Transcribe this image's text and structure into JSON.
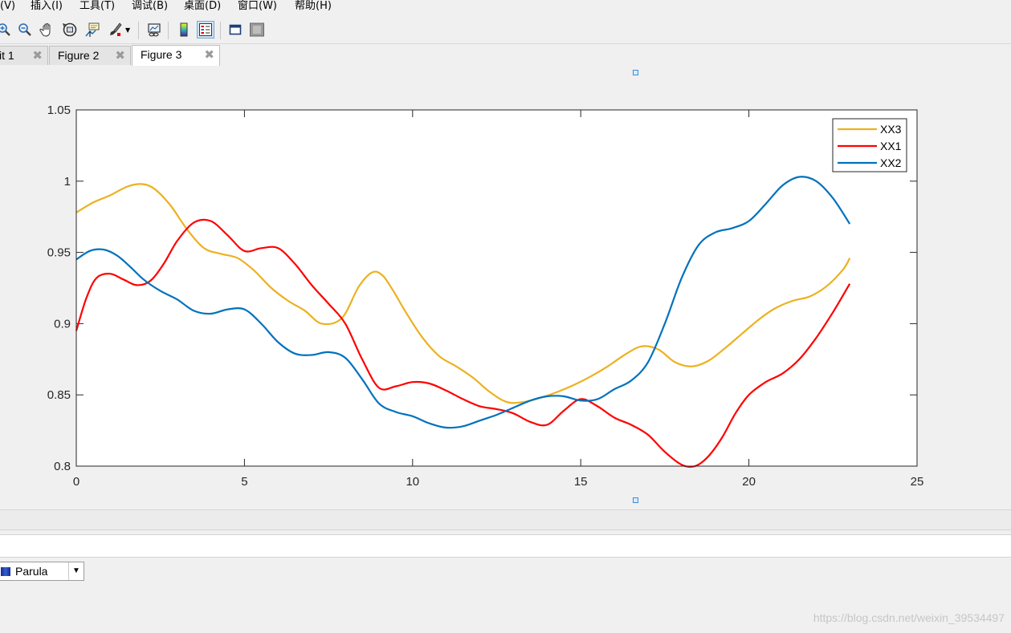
{
  "menubar": {
    "items": [
      "(V)",
      "插入(I)",
      "工具(T)",
      "调试(B)",
      "桌面(D)",
      "窗口(W)",
      "帮助(H)"
    ]
  },
  "toolbar": {
    "buttons": [
      {
        "icon": "zoom-in-icon"
      },
      {
        "icon": "zoom-out-icon"
      },
      {
        "icon": "pan-hand-icon"
      },
      {
        "icon": "rotate-3d-icon"
      },
      {
        "icon": "data-cursor-icon"
      },
      {
        "icon": "brush-icon"
      },
      {
        "icon": "link-plot-icon"
      },
      {
        "icon": "colorbar-icon"
      },
      {
        "icon": "legend-icon",
        "pressed": true
      },
      {
        "icon": "hide-plot-tools-icon"
      },
      {
        "icon": "show-plot-tools-icon"
      }
    ]
  },
  "tabs": [
    {
      "label": "it 1",
      "active": false
    },
    {
      "label": "Figure 2",
      "active": false
    },
    {
      "label": "Figure 3",
      "active": true
    }
  ],
  "colormap": {
    "selected": "Parula"
  },
  "watermark": "https://blog.csdn.net/weixin_39534497",
  "colors": {
    "XX3": "#EDB120",
    "XX1": "#FF0000",
    "XX2": "#0072BD"
  },
  "chart_data": {
    "type": "line",
    "title": "",
    "xlabel": "",
    "ylabel": "",
    "xlim": [
      0,
      25
    ],
    "ylim": [
      0.8,
      1.05
    ],
    "xticks": [
      "0",
      "5",
      "10",
      "15",
      "20",
      "25"
    ],
    "yticks": [
      "0.8",
      "0.85",
      "0.9",
      "0.95",
      "1",
      "1.05"
    ],
    "grid": false,
    "legend_position": "top-right",
    "series": [
      {
        "name": "XX3",
        "color": "#EDB120",
        "x": [
          0,
          0.5,
          1,
          1.5,
          1.9,
          2.3,
          2.8,
          3.3,
          3.8,
          4.3,
          4.8,
          5.3,
          5.8,
          6.3,
          6.8,
          7.3,
          7.9,
          8.4,
          8.8,
          9.1,
          9.4,
          9.8,
          10.3,
          10.8,
          11.3,
          11.8,
          12.3,
          12.8,
          13.3,
          13.8,
          14.3,
          14.8,
          15.3,
          15.8,
          16.3,
          16.8,
          17.3,
          17.8,
          18.3,
          18.8,
          19.3,
          19.8,
          20.3,
          20.8,
          21.3,
          21.8,
          22.3,
          22.8,
          23
        ],
        "y": [
          0.978,
          0.985,
          0.99,
          0.996,
          0.998,
          0.995,
          0.983,
          0.966,
          0.953,
          0.949,
          0.946,
          0.937,
          0.925,
          0.916,
          0.909,
          0.9,
          0.904,
          0.926,
          0.936,
          0.934,
          0.924,
          0.908,
          0.89,
          0.877,
          0.87,
          0.862,
          0.852,
          0.845,
          0.845,
          0.848,
          0.852,
          0.857,
          0.863,
          0.87,
          0.878,
          0.884,
          0.882,
          0.873,
          0.87,
          0.874,
          0.883,
          0.893,
          0.903,
          0.911,
          0.916,
          0.919,
          0.926,
          0.938,
          0.946
        ]
      },
      {
        "name": "XX1",
        "color": "#FF0000",
        "x": [
          0,
          0.3,
          0.6,
          1,
          1.4,
          1.8,
          2.2,
          2.6,
          3,
          3.5,
          4,
          4.5,
          5,
          5.5,
          6,
          6.5,
          7,
          7.5,
          8,
          8.5,
          9,
          9.5,
          10,
          10.5,
          11,
          11.5,
          12,
          12.5,
          13,
          13.5,
          14,
          14.5,
          15,
          15.5,
          16,
          16.5,
          17,
          17.5,
          18,
          18.4,
          18.8,
          19.2,
          19.6,
          20,
          20.5,
          21,
          21.5,
          22,
          22.5,
          23
        ],
        "y": [
          0.895,
          0.918,
          0.932,
          0.935,
          0.931,
          0.927,
          0.93,
          0.942,
          0.958,
          0.971,
          0.972,
          0.962,
          0.951,
          0.953,
          0.953,
          0.942,
          0.927,
          0.914,
          0.9,
          0.875,
          0.855,
          0.856,
          0.859,
          0.858,
          0.853,
          0.847,
          0.842,
          0.84,
          0.837,
          0.831,
          0.829,
          0.839,
          0.847,
          0.842,
          0.834,
          0.829,
          0.822,
          0.81,
          0.801,
          0.8,
          0.807,
          0.82,
          0.837,
          0.85,
          0.859,
          0.865,
          0.875,
          0.89,
          0.908,
          0.928
        ]
      },
      {
        "name": "XX2",
        "color": "#0072BD",
        "x": [
          0,
          0.4,
          0.8,
          1.2,
          1.6,
          2,
          2.5,
          3,
          3.5,
          4,
          4.5,
          5,
          5.5,
          6,
          6.5,
          7,
          7.5,
          8,
          8.5,
          9,
          9.5,
          10,
          10.5,
          11,
          11.5,
          12,
          12.5,
          13,
          13.5,
          14,
          14.5,
          15,
          15.5,
          16,
          16.5,
          17,
          17.5,
          18,
          18.5,
          19,
          19.5,
          20,
          20.5,
          21,
          21.5,
          22,
          22.5,
          23
        ],
        "y": [
          0.945,
          0.951,
          0.952,
          0.948,
          0.94,
          0.931,
          0.923,
          0.917,
          0.909,
          0.907,
          0.91,
          0.91,
          0.9,
          0.887,
          0.879,
          0.878,
          0.88,
          0.876,
          0.861,
          0.844,
          0.838,
          0.835,
          0.83,
          0.827,
          0.828,
          0.832,
          0.836,
          0.841,
          0.846,
          0.849,
          0.849,
          0.846,
          0.847,
          0.854,
          0.86,
          0.873,
          0.9,
          0.932,
          0.955,
          0.964,
          0.967,
          0.972,
          0.984,
          0.997,
          1.003,
          1.0,
          0.988,
          0.97
        ]
      }
    ]
  }
}
